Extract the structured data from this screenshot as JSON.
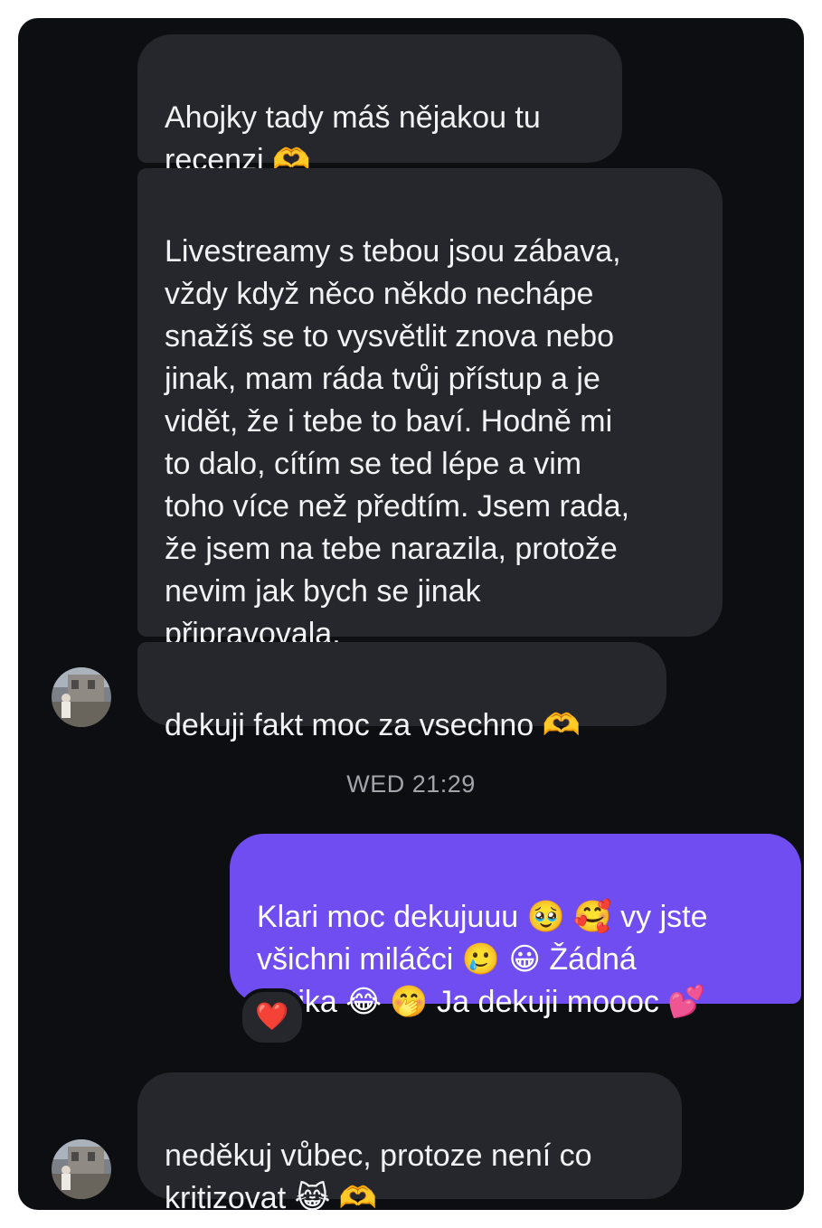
{
  "messages": [
    {
      "text": "Ahojky tady máš nějakou tu\nrecenzi 🫶"
    },
    {
      "text": "Livestreamy s tebou jsou zábava,\nvždy když něco někdo nechápe\nsnažíš se to vysvětlit znova nebo\njinak, mam ráda tvůj přístup a je\nvidět, že i tebe to baví. Hodně mi\nto dalo, cítím se ted lépe a vim\ntoho více než předtím. Jsem rada,\nže jsem na tebe narazila, protože\nnevim jak bych se jinak\npřipravovala."
    },
    {
      "text": "dekuji fakt moc za vsechno 🫶"
    },
    {
      "text": "Klari moc dekujuuu 🥹 🥰  vy jste\nvšichni miláčci 🥲 😀  Žádná\nkritika 😂 🤭  Ja dekuji moooc 💕"
    },
    {
      "text": "neděkuj vůbec, protoze není co\nkritizovat 😹 🫶"
    }
  ],
  "timestamp": "WED 21:29",
  "reaction": "❤️",
  "icons": {
    "reaction": "heart-reaction-icon",
    "avatar": "contact-avatar"
  },
  "colors": {
    "background": "#0d0e12",
    "incoming_bubble": "#26272c",
    "outgoing_bubble": "#6f4df0"
  }
}
